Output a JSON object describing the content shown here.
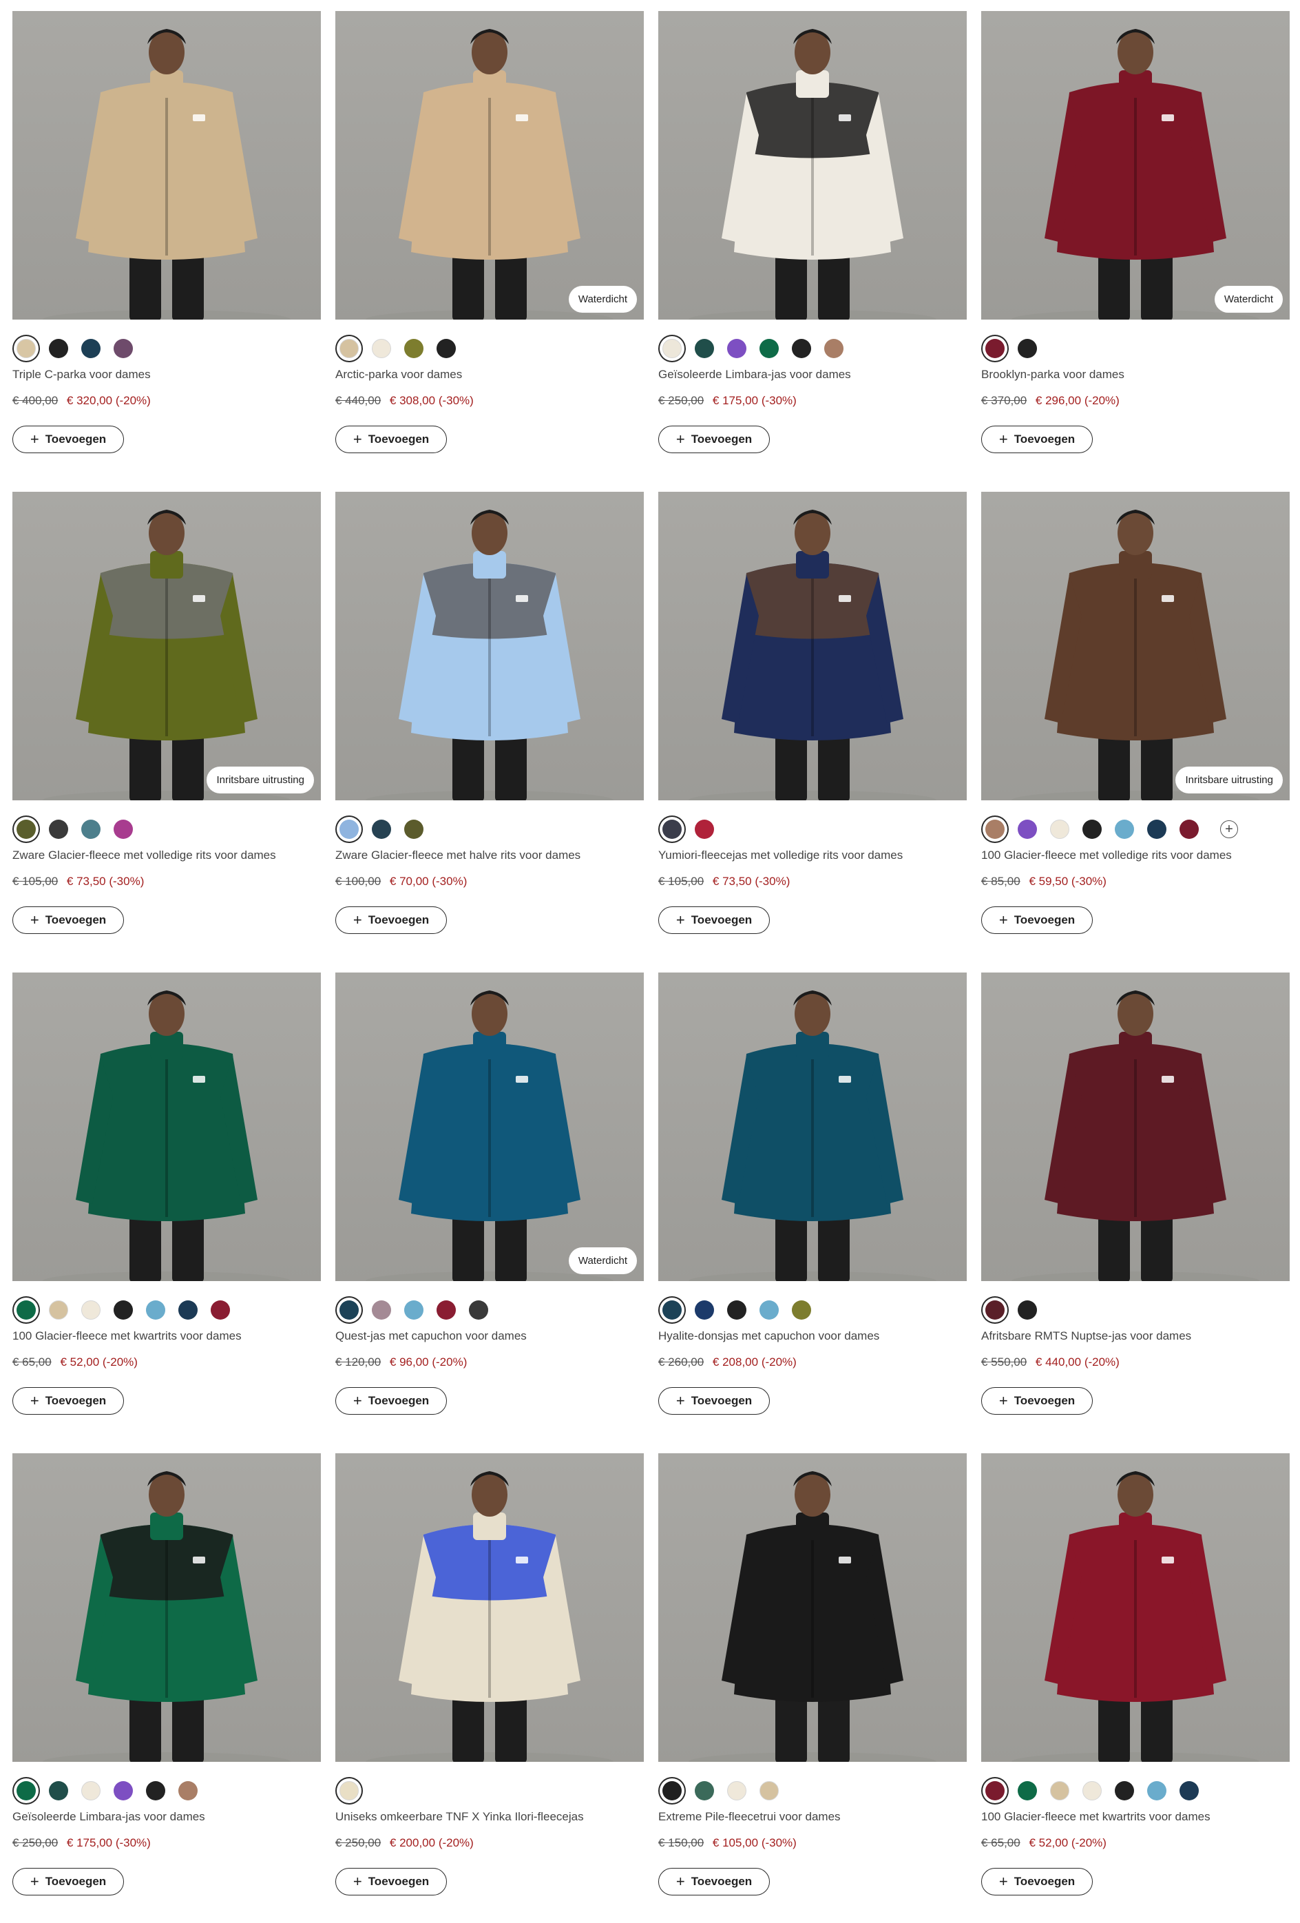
{
  "button_label": "Toevoegen",
  "products": [
    {
      "name": "Triple C-parka voor dames",
      "old_price": "€ 400,00",
      "sale_price": "€ 320,00 (-20%)",
      "badge": "",
      "jacket_color": "#cdb48e",
      "accent_color": "",
      "swatches": [
        "#d8c6a4",
        "#222222",
        "#1d3f55",
        "#6e4b6b"
      ],
      "more": false
    },
    {
      "name": "Arctic-parka voor dames",
      "old_price": "€ 440,00",
      "sale_price": "€ 308,00 (-30%)",
      "badge": "Waterdicht",
      "jacket_color": "#d2b48e",
      "accent_color": "",
      "swatches": [
        "#d5c2a0",
        "#efe8da",
        "#7d7d2e",
        "#222222"
      ],
      "more": false
    },
    {
      "name": "Geïsoleerde Limbara-jas voor dames",
      "old_price": "€ 250,00",
      "sale_price": "€ 175,00 (-30%)",
      "badge": "",
      "jacket_color": "#eeeae1",
      "accent_color": "#1b1b1b",
      "swatches": [
        "#ede7da",
        "#204e4a",
        "#7d4fc2",
        "#0e6b47",
        "#222222",
        "#a97e66"
      ],
      "more": false
    },
    {
      "name": "Brooklyn-parka voor dames",
      "old_price": "€ 370,00",
      "sale_price": "€ 296,00 (-20%)",
      "badge": "Waterdicht",
      "jacket_color": "#7d1626",
      "accent_color": "",
      "swatches": [
        "#7a1b2e",
        "#222222"
      ],
      "more": false
    },
    {
      "name": "Zware Glacier-fleece met volledige rits voor dames",
      "old_price": "€ 105,00",
      "sale_price": "€ 73,50 (-30%)",
      "badge": "Inritsbare uitrusting",
      "jacket_color": "#606a1d",
      "accent_color": "#707070",
      "swatches": [
        "#5a5e2c",
        "#3a3a3a",
        "#4d7f8c",
        "#a83c8f"
      ],
      "more": false
    },
    {
      "name": "Zware Glacier-fleece met halve rits voor dames",
      "old_price": "€ 100,00",
      "sale_price": "€ 70,00 (-30%)",
      "badge": "",
      "jacket_color": "#a6c9ec",
      "accent_color": "#606266",
      "swatches": [
        "#8fb4df",
        "#264252",
        "#5b5b2c"
      ],
      "more": false
    },
    {
      "name": "Yumiori-fleecejas met volledige rits voor dames",
      "old_price": "€ 105,00",
      "sale_price": "€ 73,50 (-30%)",
      "badge": "",
      "jacket_color": "#1f2d5a",
      "accent_color": "#5d4232",
      "swatches": [
        "#3b3d4b",
        "#b0223a"
      ],
      "more": false
    },
    {
      "name": "100 Glacier-fleece met volledige rits voor dames",
      "old_price": "€ 85,00",
      "sale_price": "€ 59,50 (-30%)",
      "badge": "Inritsbare uitrusting",
      "jacket_color": "#5e3d2b",
      "accent_color": "",
      "swatches": [
        "#a97e66",
        "#7d4fc2",
        "#efe8da",
        "#222222",
        "#6aaccc",
        "#1c3a55",
        "#7a1b2e"
      ],
      "more": true
    },
    {
      "name": "100 Glacier-fleece met kwartrits voor dames",
      "old_price": "€ 65,00",
      "sale_price": "€ 52,00 (-20%)",
      "badge": "",
      "jacket_color": "#0d5b43",
      "accent_color": "",
      "swatches": [
        "#0e6b47",
        "#d5c2a0",
        "#efe8da",
        "#222222",
        "#6aaccc",
        "#1c3a55",
        "#8a1d32"
      ],
      "more": false
    },
    {
      "name": "Quest-jas met capuchon voor dames",
      "old_price": "€ 120,00",
      "sale_price": "€ 96,00 (-20%)",
      "badge": "Waterdicht",
      "jacket_color": "#10587a",
      "accent_color": "",
      "swatches": [
        "#1c4257",
        "#a48a95",
        "#6aaccc",
        "#8a1d32",
        "#3a3a3a"
      ],
      "more": false
    },
    {
      "name": "Hyalite-donsjas met capuchon voor dames",
      "old_price": "€ 260,00",
      "sale_price": "€ 208,00 (-20%)",
      "badge": "",
      "jacket_color": "#0f4f66",
      "accent_color": "",
      "swatches": [
        "#1c4257",
        "#1c3a6a",
        "#222222",
        "#6aaccc",
        "#7d7d2e"
      ],
      "more": false
    },
    {
      "name": "Afritsbare RMTS Nuptse-jas voor dames",
      "old_price": "€ 550,00",
      "sale_price": "€ 440,00 (-20%)",
      "badge": "",
      "jacket_color": "#5e1a24",
      "accent_color": "",
      "swatches": [
        "#5a1f28",
        "#222222"
      ],
      "more": false
    },
    {
      "name": "Geïsoleerde Limbara-jas voor dames",
      "old_price": "€ 250,00",
      "sale_price": "€ 175,00 (-30%)",
      "badge": "",
      "jacket_color": "#0e6a47",
      "accent_color": "#1b1b1b",
      "swatches": [
        "#0e6b47",
        "#204e4a",
        "#efe8da",
        "#7d4fc2",
        "#222222",
        "#a97e66"
      ],
      "more": false
    },
    {
      "name": "Uniseks omkeerbare TNF X Yinka Ilori-fleecejas",
      "old_price": "€ 250,00",
      "sale_price": "€ 200,00 (-20%)",
      "badge": "",
      "jacket_color": "#e7dfcc",
      "accent_color": "#2f4fd8",
      "swatches": [
        "#e9dfc5"
      ],
      "more": false
    },
    {
      "name": "Extreme Pile-fleecetrui voor dames",
      "old_price": "€ 150,00",
      "sale_price": "€ 105,00 (-30%)",
      "badge": "",
      "jacket_color": "#1a1a1a",
      "accent_color": "",
      "swatches": [
        "#1f1f1f",
        "#3b6a5a",
        "#efe8da",
        "#d5c2a0"
      ],
      "more": false
    },
    {
      "name": "100 Glacier-fleece met kwartrits voor dames",
      "old_price": "€ 65,00",
      "sale_price": "€ 52,00 (-20%)",
      "badge": "",
      "jacket_color": "#8a1629",
      "accent_color": "",
      "swatches": [
        "#7a1b2e",
        "#0e6b47",
        "#d5c2a0",
        "#efe8da",
        "#222222",
        "#6aaccc",
        "#1c3a55"
      ],
      "more": false
    }
  ]
}
